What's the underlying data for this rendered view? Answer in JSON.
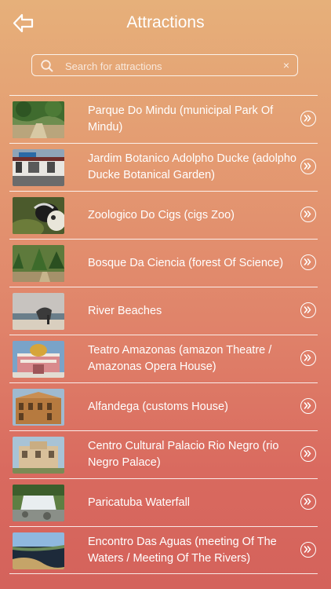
{
  "header": {
    "title": "Attractions",
    "back_icon": "back-arrow-icon"
  },
  "search": {
    "placeholder": "Search for attractions",
    "value": "",
    "search_icon": "magnifier-icon",
    "clear_icon": "clear-x-icon",
    "clear_glyph": "×"
  },
  "items": [
    {
      "label": "Parque Do Mindu (municipal Park Of Mindu)",
      "thumb": "park"
    },
    {
      "label": "Jardim Botanico Adolpho Ducke (adolpho Ducke Botanical Garden)",
      "thumb": "garden"
    },
    {
      "label": "Zoologico Do Cigs (cigs Zoo)",
      "thumb": "zoo"
    },
    {
      "label": "Bosque Da Ciencia (forest Of Science)",
      "thumb": "forest"
    },
    {
      "label": "River Beaches",
      "thumb": "beach"
    },
    {
      "label": "Teatro Amazonas (amazon Theatre / Amazonas Opera House)",
      "thumb": "theatre"
    },
    {
      "label": "Alfandega (customs House)",
      "thumb": "customs"
    },
    {
      "label": "Centro Cultural Palacio Rio Negro (rio Negro Palace)",
      "thumb": "palace"
    },
    {
      "label": "Paricatuba Waterfall",
      "thumb": "waterfall"
    },
    {
      "label": "Encontro Das Aguas (meeting Of The Waters / Meeting Of The Rivers)",
      "thumb": "waters"
    }
  ],
  "row_icon": "double-chevron-right-circle-icon"
}
